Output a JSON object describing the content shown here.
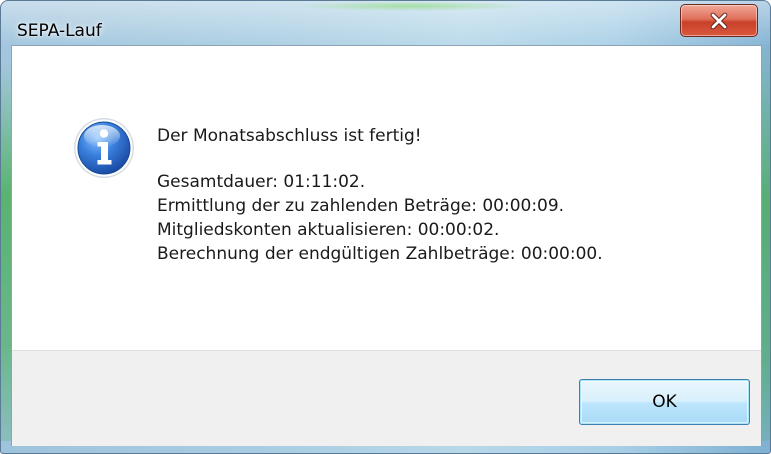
{
  "window": {
    "title": "SEPA-Lauf"
  },
  "icons": {
    "message_icon": "information-icon",
    "close_icon": "close-icon"
  },
  "message": {
    "headline": "Der Monatsabschluss ist fertig!",
    "lines": [
      "Gesamtdauer: 01:11:02.",
      "Ermittlung der zu zahlenden Beträge: 00:00:09.",
      "Mitgliedskonten aktualisieren: 00:00:02.",
      "Berechnung der endgültigen Zahlbeträge: 00:00:00."
    ]
  },
  "buttons": {
    "ok_label": "OK"
  },
  "colors": {
    "close_button": "#c8412a",
    "info_icon": "#1f5fb6",
    "ok_border": "#3c7fb1"
  }
}
